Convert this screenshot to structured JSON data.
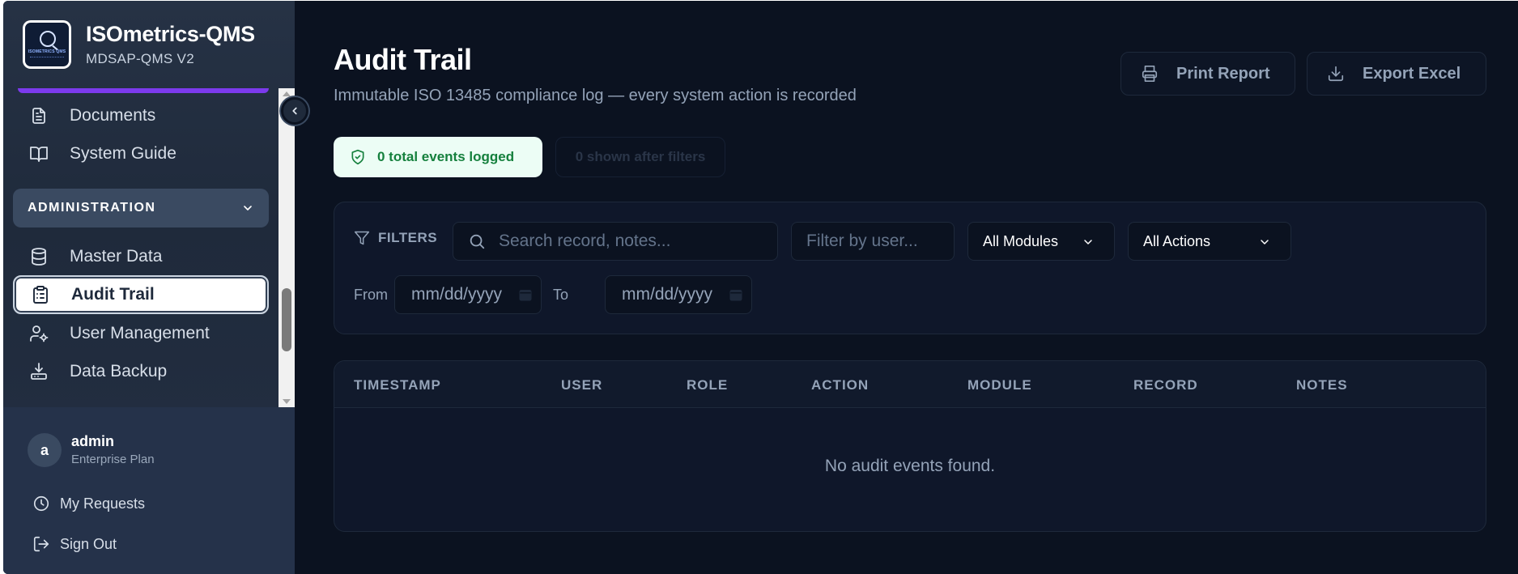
{
  "brand": {
    "title": "ISOmetrics-QMS",
    "subtitle": "MDSAP-QMS V2",
    "logo_text": "ISOMETRICS QMS"
  },
  "sidebar": {
    "items": [
      {
        "label": "Documents",
        "icon": "document-icon"
      },
      {
        "label": "System Guide",
        "icon": "book-icon"
      },
      {
        "label": "Master Data",
        "icon": "database-icon"
      },
      {
        "label": "Audit Trail",
        "icon": "clipboard-icon",
        "active": true
      },
      {
        "label": "User Management",
        "icon": "user-gear-icon"
      },
      {
        "label": "Data Backup",
        "icon": "backup-icon"
      }
    ],
    "section_label": "ADMINISTRATION"
  },
  "user": {
    "initial": "a",
    "name": "admin",
    "plan": "Enterprise Plan",
    "my_requests": "My Requests",
    "sign_out": "Sign Out"
  },
  "page": {
    "title": "Audit Trail",
    "subtitle": "Immutable ISO 13485 compliance log — every system action is recorded",
    "print_label": "Print Report",
    "export_label": "Export Excel",
    "total_events": "0 total events logged",
    "shown_after_filters": "0 shown after filters"
  },
  "filters": {
    "label": "FILTERS",
    "search_placeholder": "Search record, notes...",
    "user_placeholder": "Filter by user...",
    "module_value": "All Modules",
    "action_value": "All Actions",
    "from_label": "From",
    "to_label": "To",
    "from_placeholder": "mm/dd/yyyy",
    "to_placeholder": "mm/dd/yyyy"
  },
  "table": {
    "columns": [
      "TIMESTAMP",
      "USER",
      "ROLE",
      "ACTION",
      "MODULE",
      "RECORD",
      "NOTES"
    ],
    "empty_message": "No audit events found."
  },
  "colors": {
    "accent_green": "#15803d",
    "active_purple": "#7c3aed",
    "background": "#0b1220"
  }
}
